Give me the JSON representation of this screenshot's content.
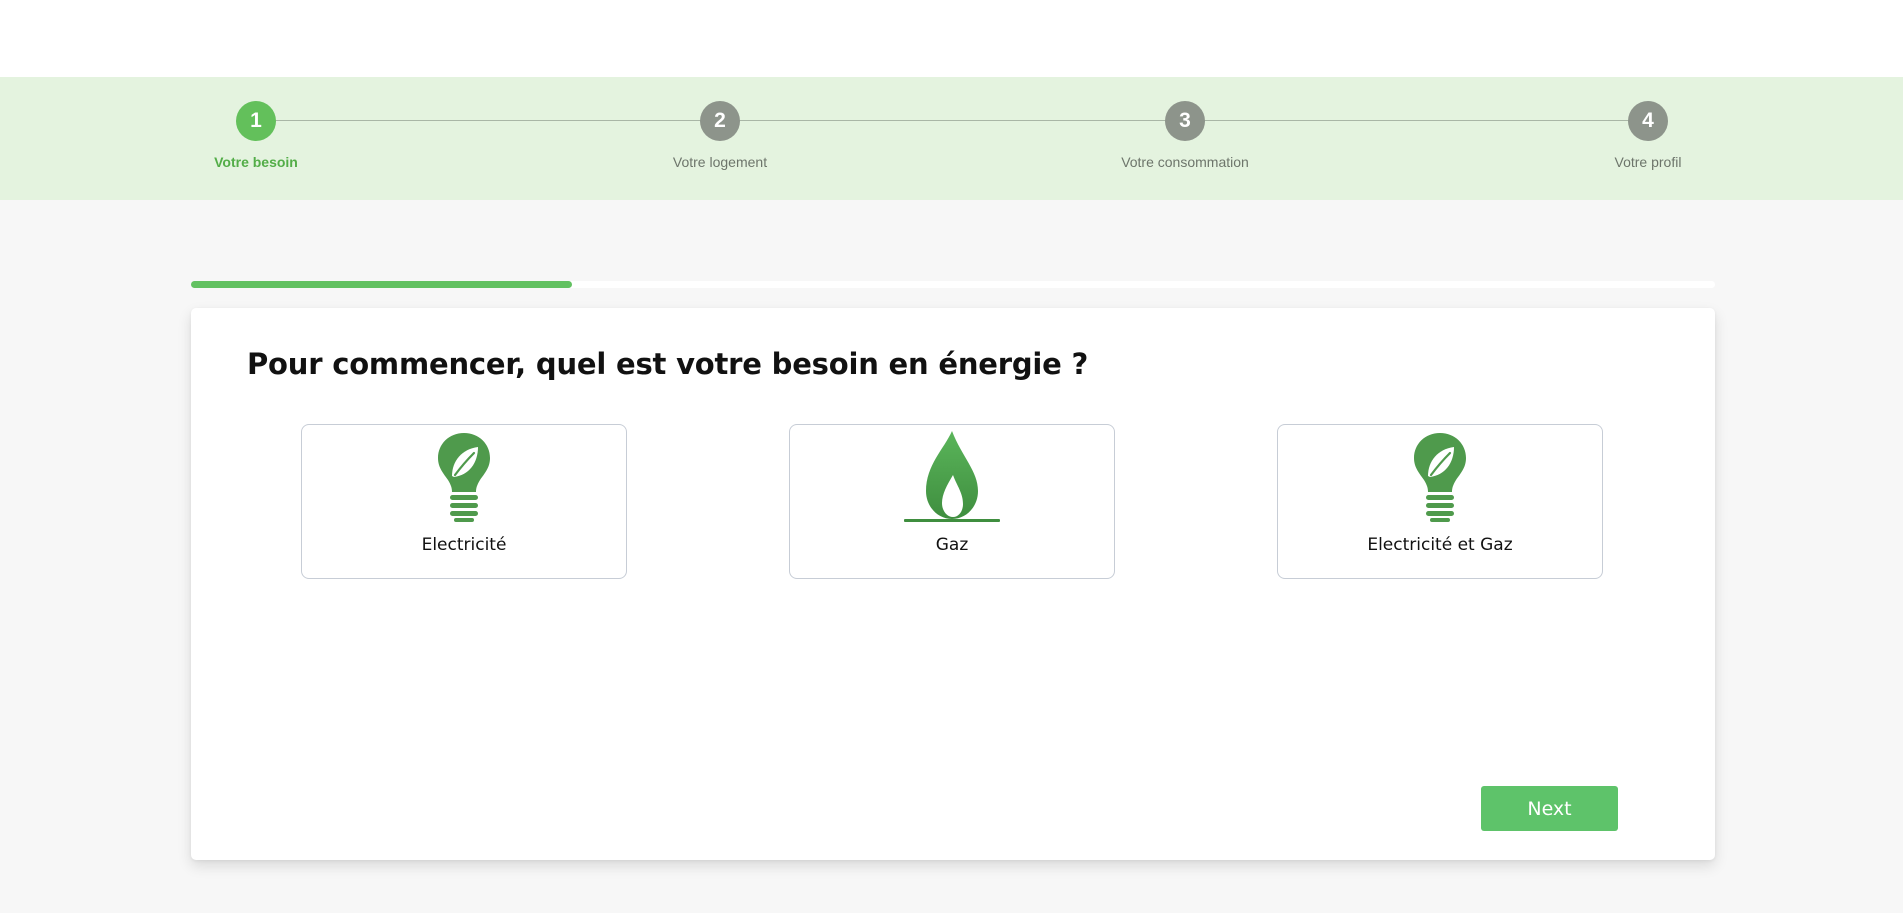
{
  "steps": [
    {
      "number": "1",
      "label": "Votre besoin",
      "active": true
    },
    {
      "number": "2",
      "label": "Votre logement",
      "active": false
    },
    {
      "number": "3",
      "label": "Votre consommation",
      "active": false
    },
    {
      "number": "4",
      "label": "Votre profil",
      "active": false
    }
  ],
  "progress": {
    "fraction": 0.25
  },
  "question": "Pour commencer, quel est votre besoin en énergie ?",
  "options": [
    {
      "label": "Electricité",
      "icon": "eco-lightbulb-icon"
    },
    {
      "label": "Gaz",
      "icon": "gas-flame-icon"
    },
    {
      "label": "Electricité et Gaz",
      "icon": "eco-lightbulb-icon"
    }
  ],
  "next_label": "Next",
  "colors": {
    "accent": "#62c161",
    "step_active": "#63c05b",
    "step_inactive": "#8d948b",
    "stepper_bg": "#e4f3df",
    "icon_green": "#4f9a4c"
  }
}
